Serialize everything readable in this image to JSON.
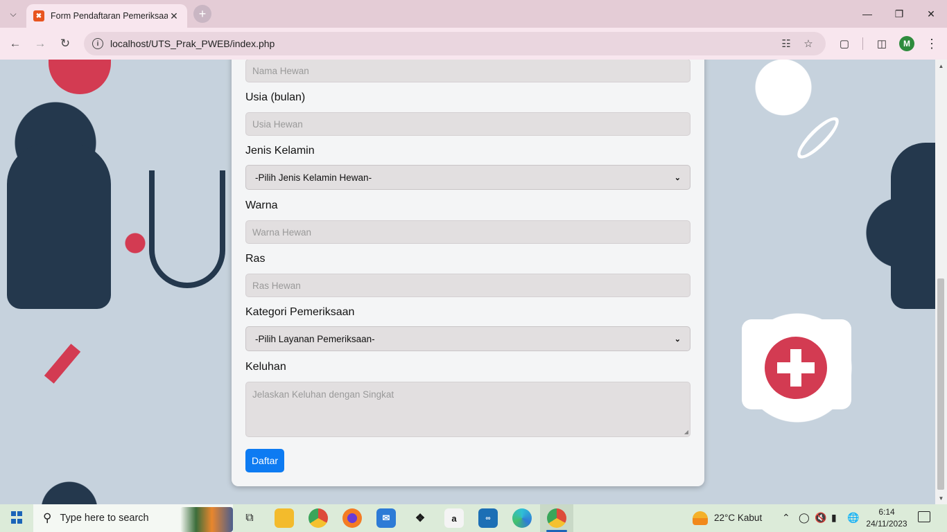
{
  "browser": {
    "tab_title": "Form Pendaftaran Pemeriksaan",
    "url": "localhost/UTS_Prak_PWEB/index.php",
    "profile_initial": "M"
  },
  "form": {
    "nama_placeholder": "Nama Hewan",
    "usia_label": "Usia (bulan)",
    "usia_placeholder": "Usia Hewan",
    "jenis_kelamin_label": "Jenis Kelamin",
    "jenis_kelamin_selected": "-Pilih Jenis Kelamin Hewan-",
    "warna_label": "Warna",
    "warna_placeholder": "Warna Hewan",
    "ras_label": "Ras",
    "ras_placeholder": "Ras Hewan",
    "kategori_label": "Kategori Pemeriksaan",
    "kategori_selected": "-Pilih Layanan Pemeriksaan-",
    "keluhan_label": "Keluhan",
    "keluhan_placeholder": "Jelaskan Keluhan dengan Singkat",
    "submit_label": "Daftar"
  },
  "taskbar": {
    "search_placeholder": "Type here to search",
    "weather": "22°C  Kabut",
    "time": "6:14",
    "date": "24/11/2023"
  },
  "colors": {
    "submit_button": "#0d7bf2",
    "browser_frame": "#e4ccd6",
    "taskbar": "#dcebd9"
  }
}
